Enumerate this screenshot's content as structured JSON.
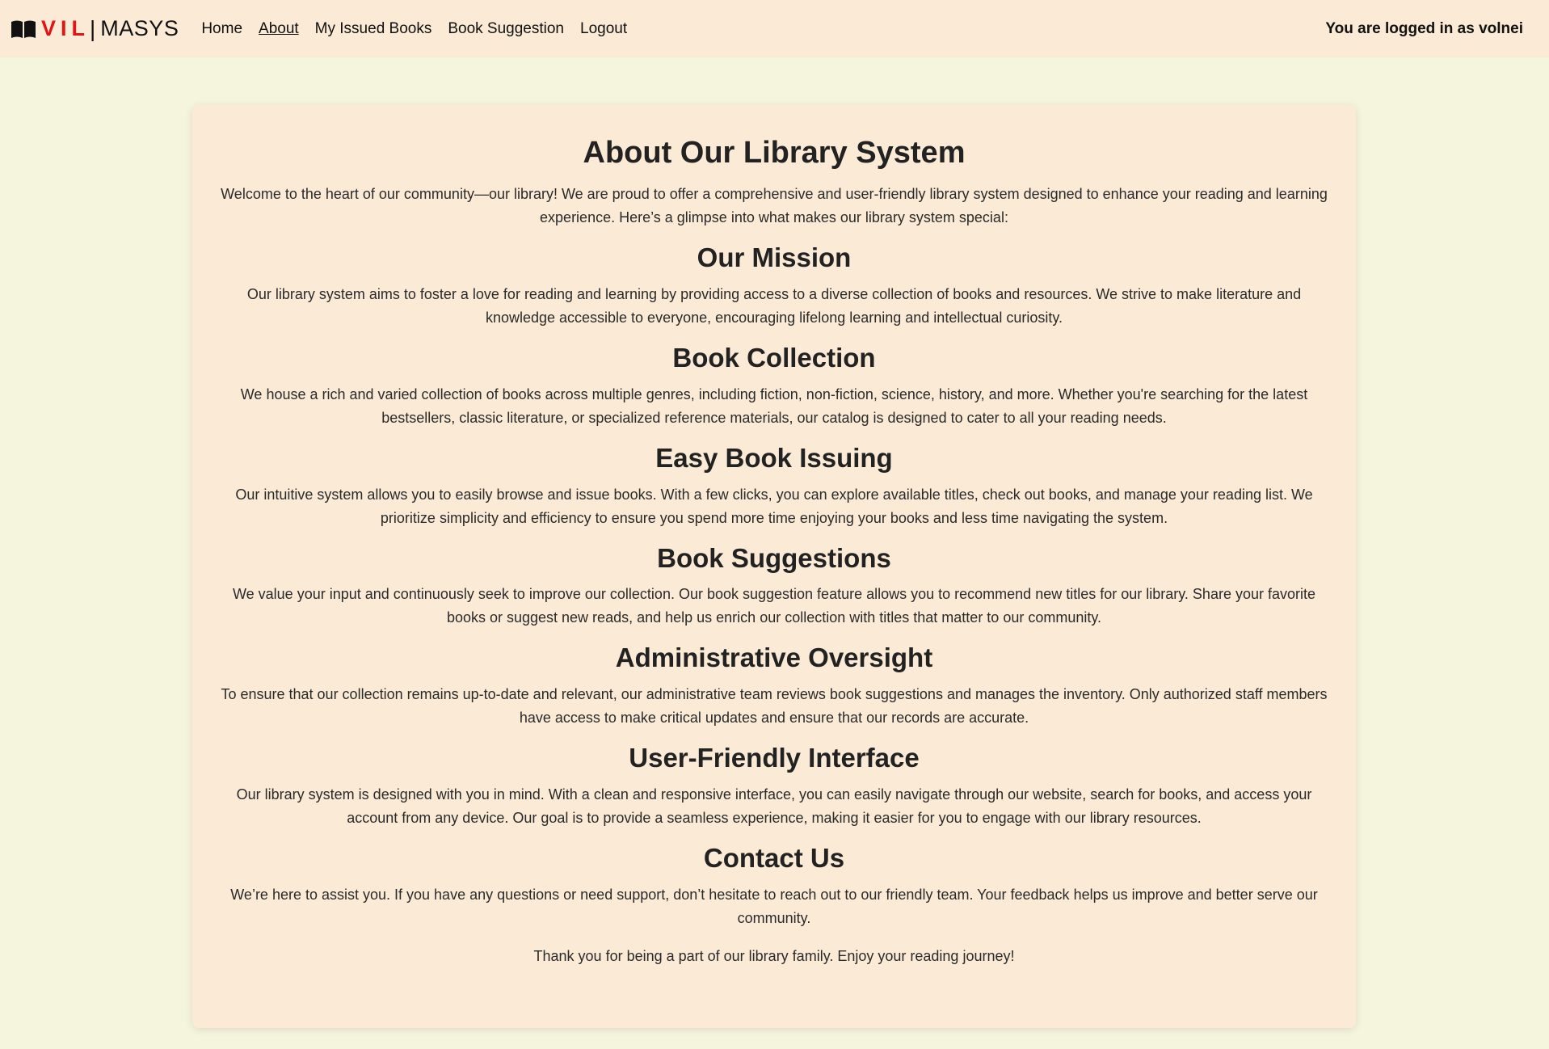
{
  "nav": {
    "brand": {
      "logo_icon": "open-book-icon",
      "vil": "VIL",
      "separator": "|",
      "masys": "MASYS",
      "accent_color": "#e01515"
    },
    "links": [
      {
        "label": "Home",
        "active": false
      },
      {
        "label": "About",
        "active": true
      },
      {
        "label": "My Issued Books",
        "active": false
      },
      {
        "label": "Book Suggestion",
        "active": false
      },
      {
        "label": "Logout",
        "active": false
      }
    ],
    "login_status": "You are logged in as volnei"
  },
  "about": {
    "title": "About Our Library System",
    "intro": "Welcome to the heart of our community—our library! We are proud to offer a comprehensive and user-friendly library system designed to enhance your reading and learning experience. Here’s a glimpse into what makes our library system special:",
    "sections": [
      {
        "heading": "Our Mission",
        "text": "Our library system aims to foster a love for reading and learning by providing access to a diverse collection of books and resources. We strive to make literature and knowledge accessible to everyone, encouraging lifelong learning and intellectual curiosity."
      },
      {
        "heading": "Book Collection",
        "text": "We house a rich and varied collection of books across multiple genres, including fiction, non-fiction, science, history, and more. Whether you're searching for the latest bestsellers, classic literature, or specialized reference materials, our catalog is designed to cater to all your reading needs."
      },
      {
        "heading": "Easy Book Issuing",
        "text": "Our intuitive system allows you to easily browse and issue books. With a few clicks, you can explore available titles, check out books, and manage your reading list. We prioritize simplicity and efficiency to ensure you spend more time enjoying your books and less time navigating the system."
      },
      {
        "heading": "Book Suggestions",
        "text": "We value your input and continuously seek to improve our collection. Our book suggestion feature allows you to recommend new titles for our library. Share your favorite books or suggest new reads, and help us enrich our collection with titles that matter to our community."
      },
      {
        "heading": "Administrative Oversight",
        "text": "To ensure that our collection remains up-to-date and relevant, our administrative team reviews book suggestions and manages the inventory. Only authorized staff members have access to make critical updates and ensure that our records are accurate."
      },
      {
        "heading": "User-Friendly Interface",
        "text": "Our library system is designed with you in mind. With a clean and responsive interface, you can easily navigate through our website, search for books, and access your account from any device. Our goal is to provide a seamless experience, making it easier for you to engage with our library resources."
      },
      {
        "heading": "Contact Us",
        "text": "We’re here to assist you. If you have any questions or need support, don’t hesitate to reach out to our friendly team. Your feedback helps us improve and better serve our community."
      }
    ],
    "closing": "Thank you for being a part of our library family. Enjoy your reading journey!"
  },
  "colors": {
    "page_background": "#f5f4dc",
    "nav_background": "#fbebd6",
    "card_background": "#fbebd6",
    "text": "#222222"
  }
}
